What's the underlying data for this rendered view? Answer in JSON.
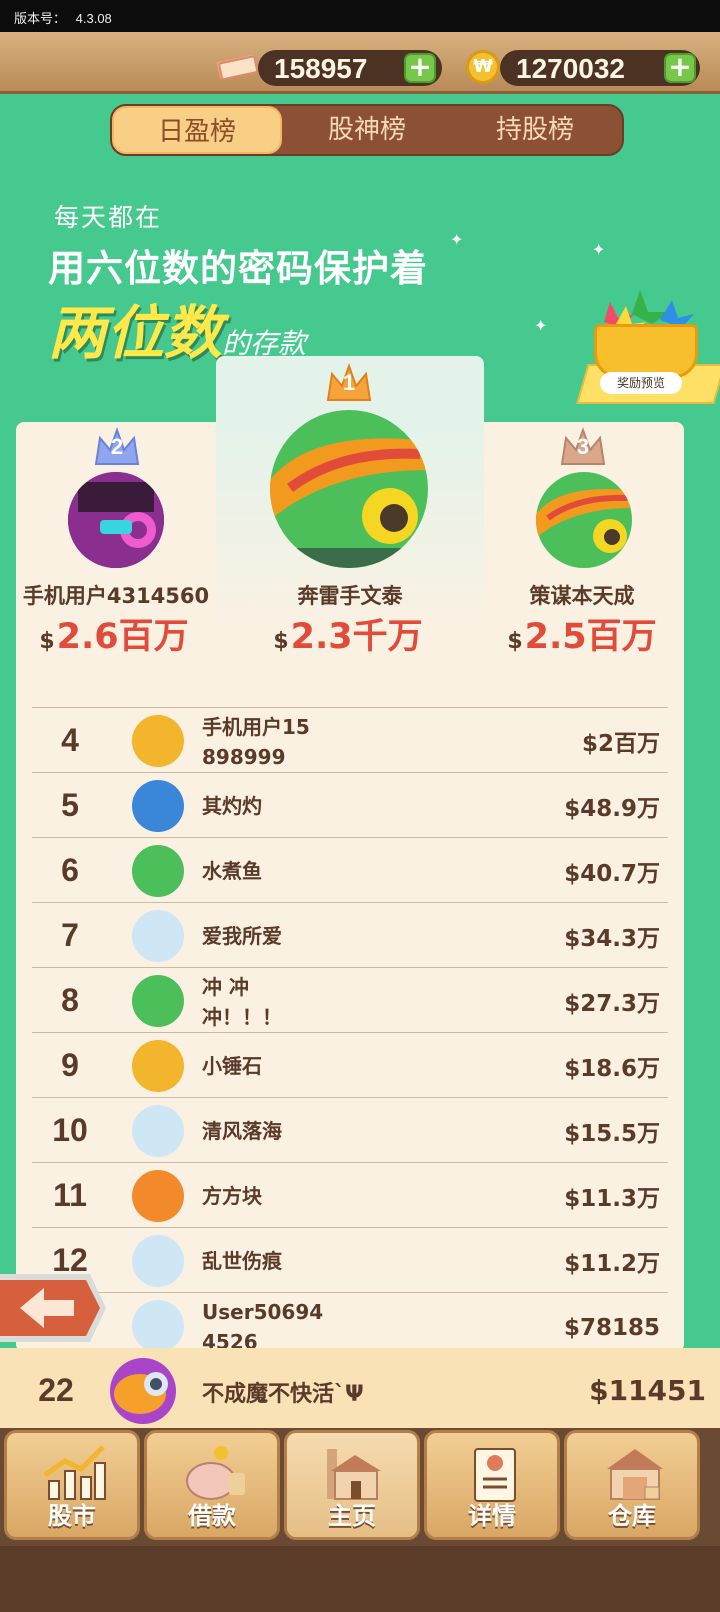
{
  "version": {
    "label": "版本号：",
    "value": "4.3.08"
  },
  "currency": {
    "cash": "158957",
    "coins": "1270032",
    "coin_symbol": "₩"
  },
  "tabs": [
    {
      "label": "日盈榜",
      "active": true
    },
    {
      "label": "股神榜",
      "active": false
    },
    {
      "label": "持股榜",
      "active": false
    }
  ],
  "banner": {
    "line1": "每天都在",
    "line2": "用六位数的密码保护着",
    "highlight": "两位数",
    "tail": "的存款"
  },
  "reward": {
    "label": "奖励预览"
  },
  "podium": [
    {
      "rank": "2",
      "name": "手机用户4314560",
      "currency": "$",
      "amount": "2.6百万",
      "avatar_icon": "robot-purple-avatar-icon"
    },
    {
      "rank": "1",
      "name": "奔雷手文泰",
      "currency": "$",
      "amount": "2.3千万",
      "avatar_icon": "tank-sombrero-avatar-icon"
    },
    {
      "rank": "3",
      "name": "策谋本天成",
      "currency": "$",
      "amount": "2.5百万",
      "avatar_icon": "tank-sombrero-avatar-icon"
    }
  ],
  "rows": [
    {
      "rank": "4",
      "name": "手机用户15",
      "name2": "898999",
      "value": "$2百万",
      "avatar": "yellow-robot"
    },
    {
      "rank": "5",
      "name": "其灼灼",
      "name2": "",
      "value": "$48.9万",
      "avatar": "blue-robot"
    },
    {
      "rank": "6",
      "name": "水煮鱼",
      "name2": "",
      "value": "$40.7万",
      "avatar": "green-tank"
    },
    {
      "rank": "7",
      "name": "爱我所爱",
      "name2": "",
      "value": "$34.3万",
      "avatar": "white-cap"
    },
    {
      "rank": "8",
      "name": "冲 冲",
      "name2": "冲！！！",
      "value": "$27.3万",
      "avatar": "green-tank"
    },
    {
      "rank": "9",
      "name": "小锤石",
      "name2": "",
      "value": "$18.6万",
      "avatar": "yellow-robot"
    },
    {
      "rank": "10",
      "name": "清风落海",
      "name2": "",
      "value": "$15.5万",
      "avatar": "white-cap"
    },
    {
      "rank": "11",
      "name": "方方块",
      "name2": "",
      "value": "$11.3万",
      "avatar": "orange-fish"
    },
    {
      "rank": "12",
      "name": "乱世伤痕",
      "name2": "",
      "value": "$11.2万",
      "avatar": "white-cap"
    },
    {
      "rank": "",
      "name": "User50694",
      "name2": "4526",
      "value": "$78185",
      "avatar": "white-cap"
    }
  ],
  "me": {
    "rank": "22",
    "name": "不成魔不快活`Ψ",
    "value": "$11451"
  },
  "nav": [
    {
      "label": "股市",
      "icon": "stock-chart-icon"
    },
    {
      "label": "借款",
      "icon": "piggy-bank-icon"
    },
    {
      "label": "主页",
      "icon": "home-icon",
      "active": true
    },
    {
      "label": "详情",
      "icon": "profile-card-icon"
    },
    {
      "label": "仓库",
      "icon": "warehouse-icon"
    }
  ],
  "colors": {
    "bg_green": "#45c98e",
    "accent_red": "#e04b3a",
    "brown": "#5a3a29",
    "gold": "#f9cf85"
  }
}
